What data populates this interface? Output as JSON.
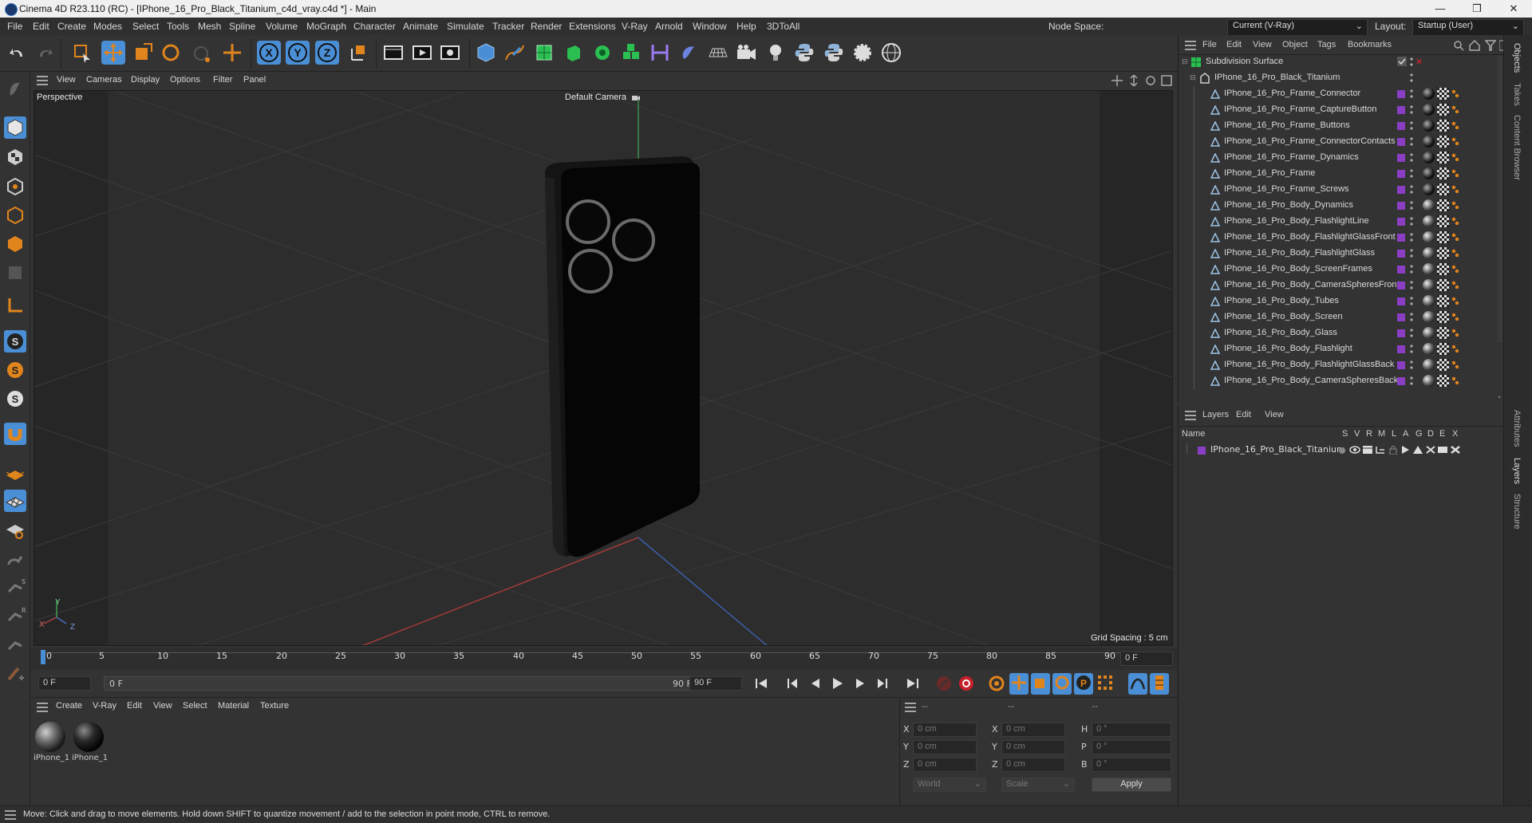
{
  "window": {
    "title": "Cinema 4D R23.110 (RC) - [IPhone_16_Pro_Black_Titanium_c4d_vray.c4d *] - Main"
  },
  "menubar": {
    "items": [
      "File",
      "Edit",
      "Create",
      "Modes",
      "Select",
      "Tools",
      "Mesh",
      "Spline",
      "Volume",
      "MoGraph",
      "Character",
      "Animate",
      "Simulate",
      "Tracker",
      "Render",
      "Extensions",
      "V-Ray",
      "Arnold",
      "Window",
      "Help",
      "3DToAll"
    ],
    "node_space_label": "Node Space:",
    "node_space_value": "Current (V-Ray)",
    "layout_label": "Layout:",
    "layout_value": "Startup (User)"
  },
  "viewport": {
    "menu": [
      "View",
      "Cameras",
      "Display",
      "Options",
      "Filter",
      "Panel"
    ],
    "view_name": "Perspective",
    "camera_label": "Default Camera",
    "grid_spacing": "Grid Spacing : 5 cm",
    "axis_labels": {
      "x": "X",
      "y": "Y",
      "z": "Z"
    }
  },
  "timeline": {
    "ticks": [
      "0",
      "5",
      "10",
      "15",
      "20",
      "25",
      "30",
      "35",
      "40",
      "45",
      "50",
      "55",
      "60",
      "65",
      "70",
      "75",
      "80",
      "85",
      "90"
    ],
    "current_frame": "0 F",
    "start_field": "0 F",
    "range_start": "0 F",
    "range_end": "90 F",
    "end_field": "90 F"
  },
  "material_manager": {
    "menu": [
      "Create",
      "V-Ray",
      "Edit",
      "View",
      "Select",
      "Material",
      "Texture"
    ],
    "materials": [
      {
        "label": "iPhone_1"
      },
      {
        "label": "iPhone_1"
      }
    ]
  },
  "coordinates": {
    "headers": [
      "--",
      "--",
      "--"
    ],
    "rows": [
      {
        "a": "X",
        "a_val": "0 cm",
        "b": "X",
        "b_val": "0 cm",
        "c": "H",
        "c_val": "0 °"
      },
      {
        "a": "Y",
        "a_val": "0 cm",
        "b": "Y",
        "b_val": "0 cm",
        "c": "P",
        "c_val": "0 °"
      },
      {
        "a": "Z",
        "a_val": "0 cm",
        "b": "Z",
        "b_val": "0 cm",
        "c": "B",
        "c_val": "0 °"
      }
    ],
    "world_select": "World",
    "scale_select": "Scale",
    "apply_label": "Apply"
  },
  "object_manager": {
    "menu": [
      "File",
      "Edit",
      "View",
      "Object",
      "Tags",
      "Bookmarks"
    ],
    "root": "Subdivision Surface",
    "group": "IPhone_16_Pro_Black_Titanium",
    "children": [
      "IPhone_16_Pro_Frame_Connector",
      "IPhone_16_Pro_Frame_CaptureButton",
      "IPhone_16_Pro_Frame_Buttons",
      "IPhone_16_Pro_Frame_ConnectorContacts",
      "IPhone_16_Pro_Frame_Dynamics",
      "IPhone_16_Pro_Frame",
      "IPhone_16_Pro_Frame_Screws",
      "IPhone_16_Pro_Body_Dynamics",
      "IPhone_16_Pro_Body_FlashlightLine",
      "IPhone_16_Pro_Body_FlashlightGlassFront",
      "IPhone_16_Pro_Body_FlashlightGlass",
      "IPhone_16_Pro_Body_ScreenFrames",
      "IPhone_16_Pro_Body_CameraSpheresFront",
      "IPhone_16_Pro_Body_Tubes",
      "IPhone_16_Pro_Body_Screen",
      "IPhone_16_Pro_Body_Glass",
      "IPhone_16_Pro_Body_Flashlight",
      "IPhone_16_Pro_Body_FlashlightGlassBack",
      "IPhone_16_Pro_Body_CameraSpheresBack"
    ]
  },
  "layer_manager": {
    "menu": [
      "Layers",
      "Edit",
      "View"
    ],
    "columns": {
      "name": "Name",
      "flags": [
        "S",
        "V",
        "R",
        "M",
        "L",
        "A",
        "G",
        "D",
        "E",
        "X"
      ]
    },
    "layers": [
      {
        "name": "IPhone_16_Pro_Black_Titanium",
        "color": "#8a3ec4"
      }
    ]
  },
  "side_tabs": [
    "Objects",
    "Takes",
    "Content Browser",
    "Attributes",
    "Layers",
    "Structure"
  ],
  "status": {
    "text": "Move: Click and drag to move elements. Hold down SHIFT to quantize movement / add to the selection in point mode, CTRL to remove."
  },
  "colors": {
    "accent_blue": "#4a8fd6",
    "layer_purple": "#8a3ec4",
    "orange": "#e0841c"
  }
}
